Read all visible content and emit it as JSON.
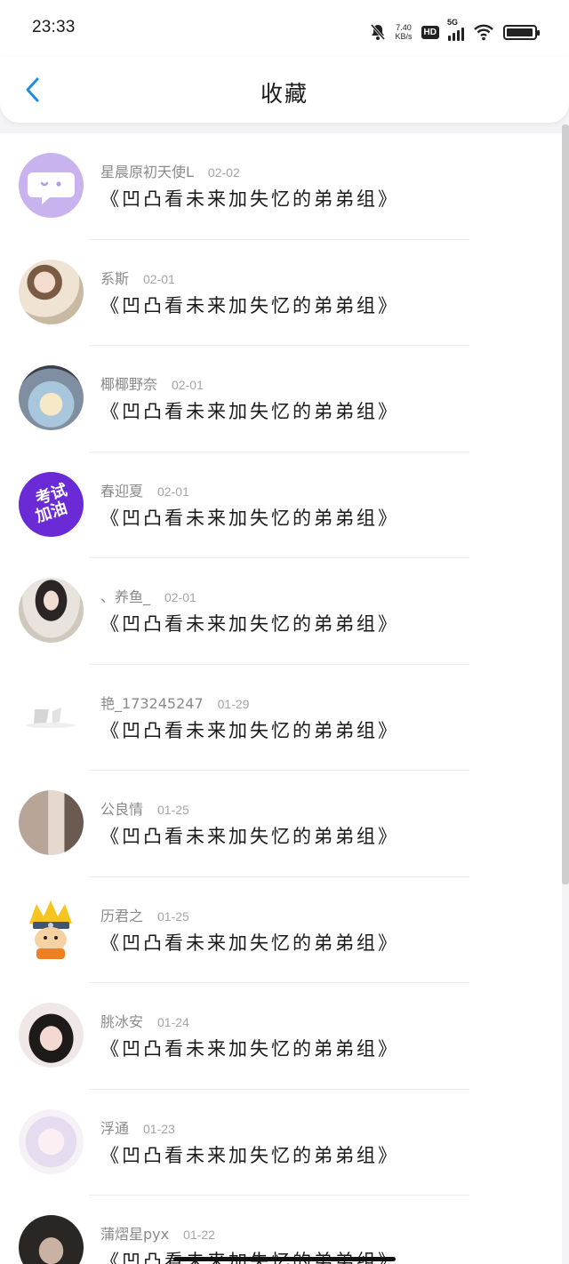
{
  "status_bar": {
    "time": "23:33",
    "net_speed_value": "7.40",
    "net_speed_unit": "KB/s",
    "hd_label": "HD",
    "signal_label": "5G",
    "battery_level": 0.95,
    "icons": [
      "mute-bell-icon",
      "signal-icon",
      "wifi-icon",
      "battery-icon"
    ]
  },
  "header": {
    "title": "收藏",
    "back_icon": "chevron-left-icon",
    "accent_color": "#1e8ee0"
  },
  "favorites": [
    {
      "name": "星晨原初天使L",
      "date": "02-02",
      "content": "《凹凸看未来加失忆的弟弟组》",
      "avatar": "purple-chat-bubble"
    },
    {
      "name": "系斯",
      "date": "02-01",
      "content": "《凹凸看未来加失忆的弟弟组》",
      "avatar": "photo"
    },
    {
      "name": "椰椰野奈",
      "date": "02-01",
      "content": "《凹凸看未来加失忆的弟弟组》",
      "avatar": "anime"
    },
    {
      "name": "春迎夏",
      "date": "02-01",
      "content": "《凹凸看未来加失忆的弟弟组》",
      "avatar": "badge",
      "avatar_text_1": "考试",
      "avatar_text_2": "加油"
    },
    {
      "name": "、养鱼_",
      "date": "02-01",
      "content": "《凹凸看未来加失忆的弟弟组》",
      "avatar": "photo"
    },
    {
      "name": "艳_173245247",
      "date": "01-29",
      "content": "《凹凸看未来加失忆的弟弟组》",
      "avatar": "faded"
    },
    {
      "name": "公良情",
      "date": "01-25",
      "content": "《凹凸看未来加失忆的弟弟组》",
      "avatar": "photo"
    },
    {
      "name": "历君之",
      "date": "01-25",
      "content": "《凹凸看未来加失忆的弟弟组》",
      "avatar": "cartoon"
    },
    {
      "name": "朓冰安",
      "date": "01-24",
      "content": "《凹凸看未来加失忆的弟弟组》",
      "avatar": "photo"
    },
    {
      "name": "浮通",
      "date": "01-23",
      "content": "《凹凸看未来加失忆的弟弟组》",
      "avatar": "anime"
    },
    {
      "name": "蒲熠星pyx",
      "date": "01-22",
      "content": "《凹凸看未来加失忆的弟弟组》",
      "avatar": "photo"
    }
  ]
}
